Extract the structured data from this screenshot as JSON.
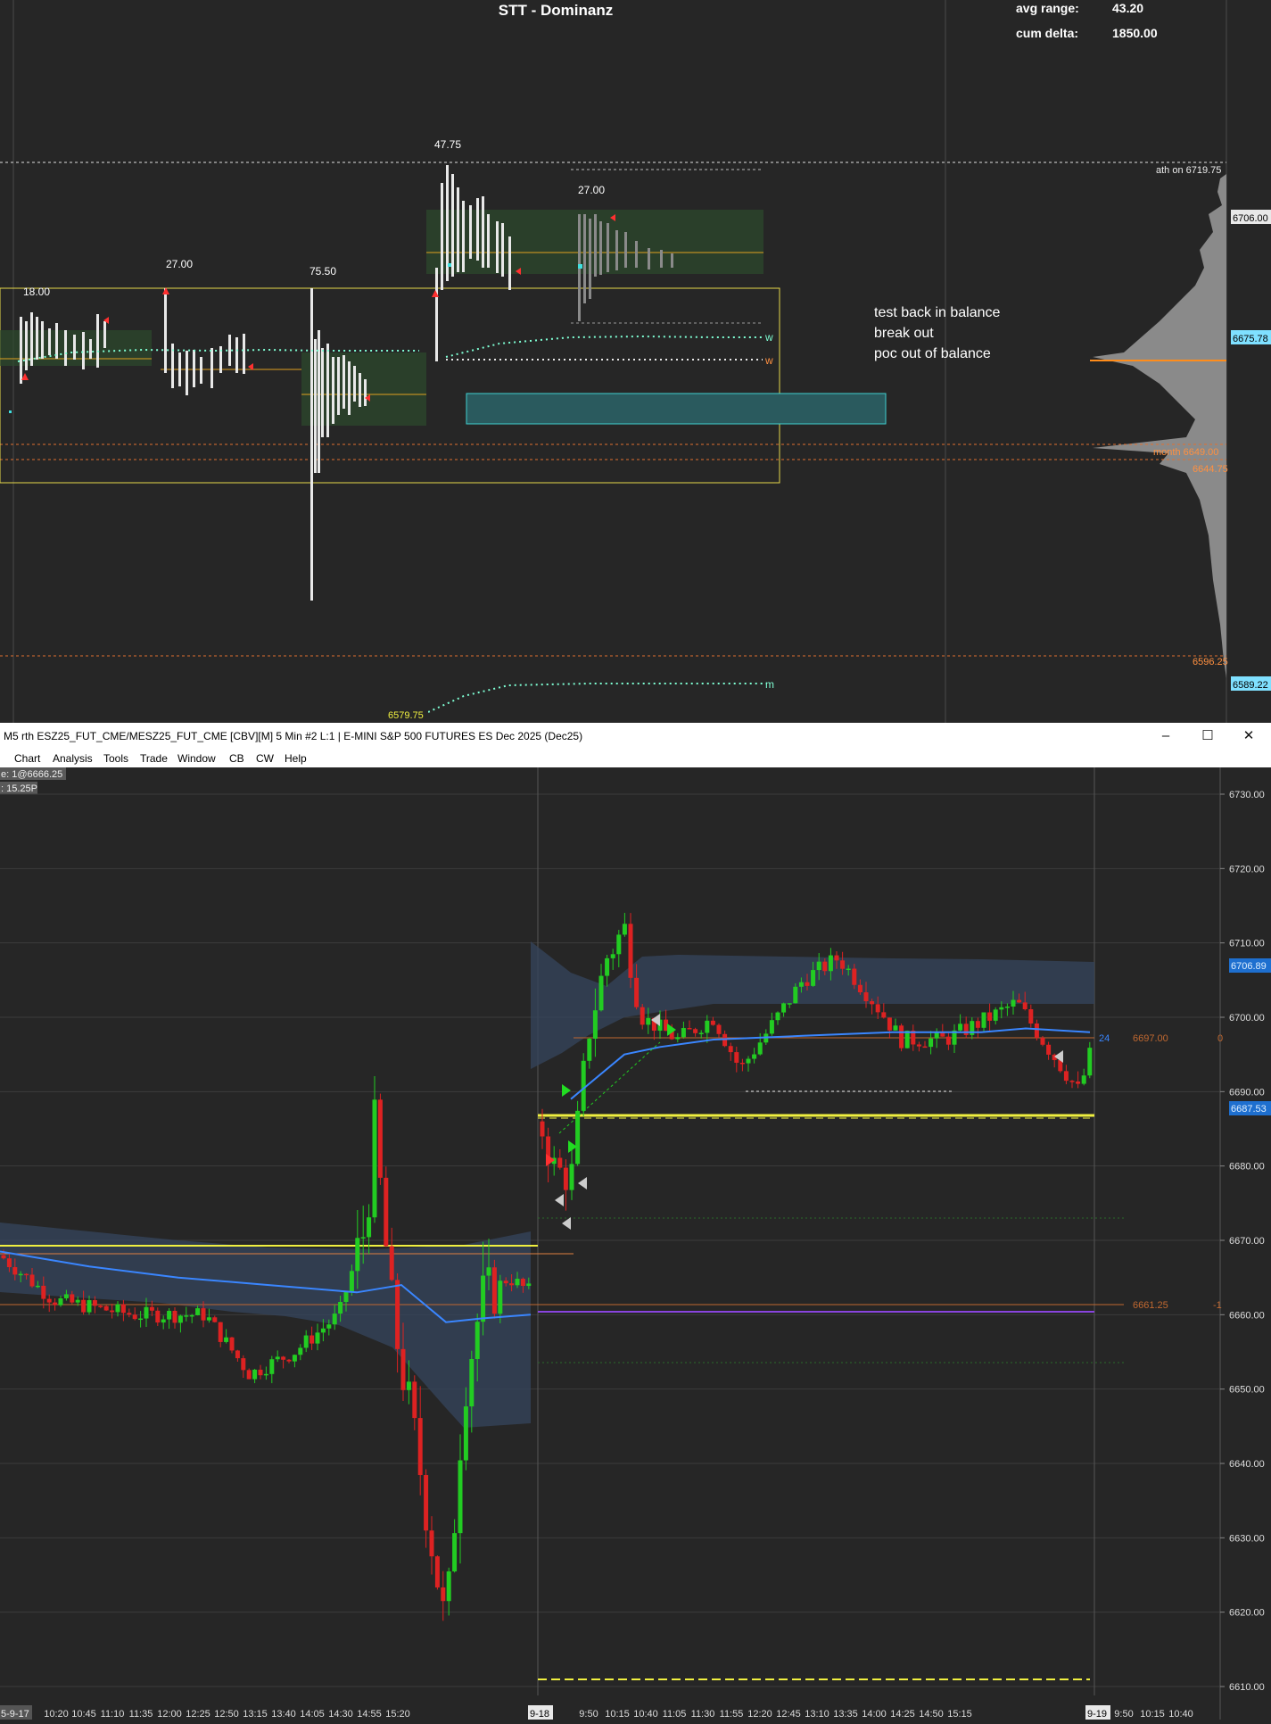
{
  "top_chart": {
    "title": "STT - Dominanz",
    "stats": [
      {
        "label": "avg range:",
        "value": "43.20"
      },
      {
        "label": "cum delta:",
        "value": "1850.00"
      }
    ],
    "range_labels": [
      "18.00",
      "27.00",
      "75.50",
      "47.75",
      "27.00"
    ],
    "annotation_lines": [
      "test back in balance",
      "break out",
      "poc out of balance"
    ],
    "level_labels": {
      "ath": "ath on  6719.75",
      "month": "month  6649.00",
      "low1": "6644.75",
      "low2": "6596.25",
      "bottom": "6579.75"
    },
    "price_tags": {
      "upper": "6706.00",
      "middle": "6675.78",
      "lower": "6589.22"
    },
    "vwap_markers": [
      "w",
      "w",
      "m"
    ]
  },
  "window": {
    "title": "M5 rth ESZ25_FUT_CME/MESZ25_FUT_CME [CBV][M]  5 Min  #2 L:1 | E-MINI S&P 500 FUTURES ES Dec 2025 (Dec25)",
    "controls": [
      "minimize-icon",
      "maximize-icon",
      "close-icon"
    ],
    "control_glyphs": [
      "–",
      "☐",
      "✕"
    ],
    "menu": [
      "Chart",
      "Analysis",
      "Tools",
      "Trade",
      "Window",
      "CB",
      "CW",
      "Help"
    ],
    "info_badges": [
      "e: 1@6666.25",
      ": 15.25P"
    ]
  },
  "price_chart": {
    "y_ticks": [
      "6730.00",
      "6720.00",
      "6710.00",
      "6700.00",
      "6690.00",
      "6680.00",
      "6670.00",
      "6660.00",
      "6650.00",
      "6640.00",
      "6630.00",
      "6620.00",
      "6610.00"
    ],
    "x_ticks": [
      "10:20",
      "10:45",
      "11:10",
      "11:35",
      "12:00",
      "12:25",
      "12:50",
      "13:15",
      "13:40",
      "14:05",
      "14:30",
      "14:55",
      "15:20",
      "9:50",
      "10:15",
      "10:40",
      "11:05",
      "11:30",
      "11:55",
      "12:20",
      "12:45",
      "13:10",
      "13:35",
      "14:00",
      "14:25",
      "14:50",
      "15:15",
      "9:50",
      "10:15",
      "10:40"
    ],
    "date_markers": [
      "5-9-17",
      "9-18",
      "9-19"
    ],
    "price_tags": {
      "upper": "6706.89",
      "lower": "6687.53"
    },
    "level_labels": {
      "l1": "6697.00",
      "l1_right": "0",
      "l1_small": "24",
      "l2": "6661.25",
      "l2_right": "-1"
    },
    "colors": {
      "up": "#22cc22",
      "down": "#dd2222",
      "vwap": "#3a86ff",
      "accent": "#f0f040"
    }
  }
}
